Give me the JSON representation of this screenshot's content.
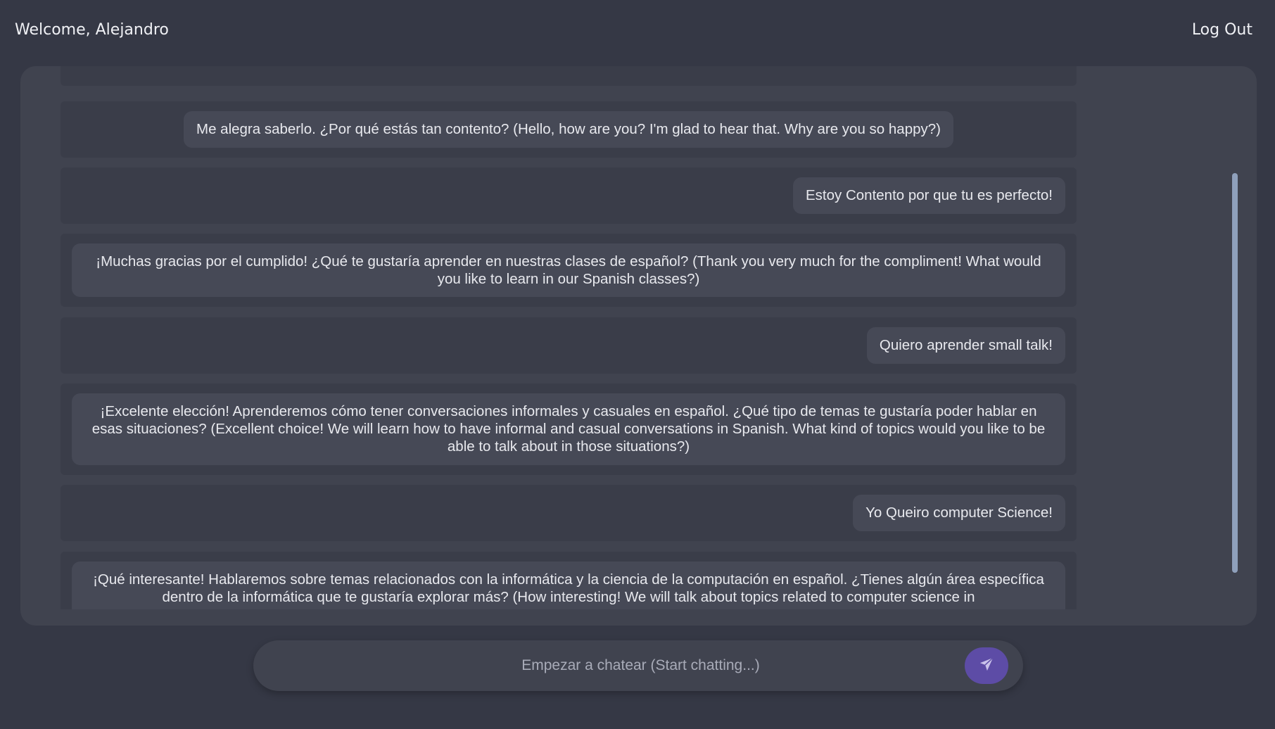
{
  "header": {
    "welcome": "Welcome, Alejandro",
    "logout_label": "Log Out"
  },
  "messages": [
    {
      "role": "bot",
      "text": "Me alegra saberlo. ¿Por qué estás tan contento? (Hello, how are you? I'm glad to hear that. Why are you so happy?)"
    },
    {
      "role": "user",
      "text": "Estoy Contento por que tu es perfecto!"
    },
    {
      "role": "bot",
      "text": "¡Muchas gracias por el cumplido! ¿Qué te gustaría aprender en nuestras clases de español? (Thank you very much for the compliment! What would you like to learn in our Spanish classes?)"
    },
    {
      "role": "user",
      "text": "Quiero aprender small talk!"
    },
    {
      "role": "bot",
      "text": "¡Excelente elección! Aprenderemos cómo tener conversaciones informales y casuales en español. ¿Qué tipo de temas te gustaría poder hablar en esas situaciones? (Excellent choice! We will learn how to have informal and casual conversations in Spanish. What kind of topics would you like to be able to talk about in those situations?)"
    },
    {
      "role": "user",
      "text": "Yo Queiro computer Science!"
    },
    {
      "role": "bot",
      "text": "¡Qué interesante! Hablaremos sobre temas relacionados con la informática y la ciencia de la computación en español. ¿Tienes algún área específica dentro de la informática que te gustaría explorar más? (How interesting! We will talk about topics related to computer science in"
    }
  ],
  "composer": {
    "placeholder": "Empezar a chatear (Start chatting...)",
    "value": ""
  },
  "icons": {
    "send": "paper-plane-icon"
  },
  "colors": {
    "background": "#353845",
    "panel": "#40434f",
    "send_button": "#5d4ca6",
    "scrollbar": "#8fa0bb"
  }
}
